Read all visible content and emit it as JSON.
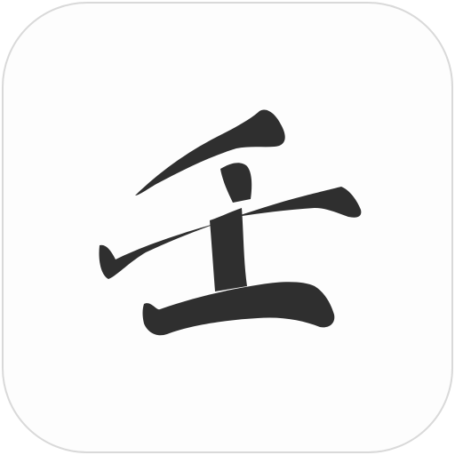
{
  "app_icon": {
    "name": "壬",
    "glyph_color": "#2f2f2f",
    "background_color": "#fdfdfd",
    "border_color": "#d9d9d9"
  }
}
